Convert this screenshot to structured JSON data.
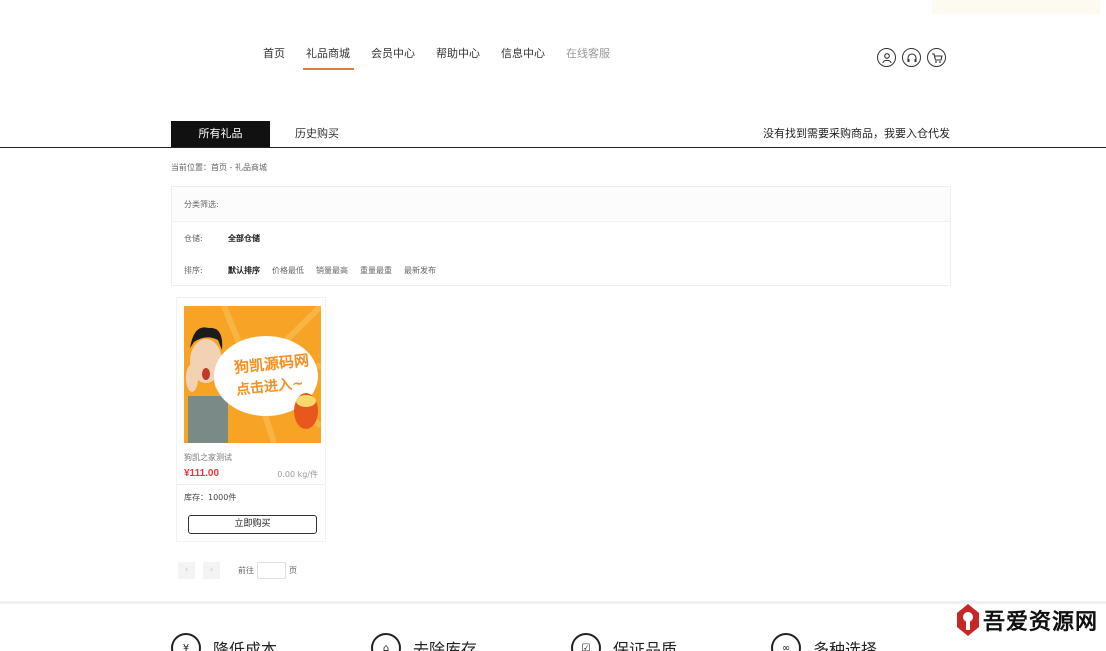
{
  "nav": {
    "items": [
      {
        "label": "首页",
        "state": "normal"
      },
      {
        "label": "礼品商城",
        "state": "active"
      },
      {
        "label": "会员中心",
        "state": "normal"
      },
      {
        "label": "帮助中心",
        "state": "normal"
      },
      {
        "label": "信息中心",
        "state": "normal"
      },
      {
        "label": "在线客服",
        "state": "muted"
      }
    ],
    "icons": [
      "user-icon",
      "headset-icon",
      "cart-icon"
    ]
  },
  "tabs": {
    "all_gifts": "所有礼品",
    "history": "历史购买",
    "right_link": "没有找到需要采购商品，我要入仓代发"
  },
  "breadcrumb": "当前位置：首页 - 礼品商城",
  "filters": {
    "category_label": "分类筛选:",
    "warehouse_label": "仓储:",
    "warehouse_selected": "全部仓储",
    "sort_label": "排序:",
    "sort_options": [
      "默认排序",
      "价格最低",
      "销量最高",
      "重量最重",
      "最新发布"
    ]
  },
  "product": {
    "image_text_line1": "狗凯源码网",
    "image_text_line2": "点击进入~",
    "name": "狗凯之家测试",
    "price": "¥111.00",
    "weight": "0.00 kg/件",
    "stock": "库存：1000件",
    "buy_label": "立即购买"
  },
  "pagination": {
    "prev": "‹",
    "next": "›",
    "goto_prefix": "前往",
    "goto_suffix": "页"
  },
  "features": [
    {
      "label": "降低成本",
      "icon": "coin-icon"
    },
    {
      "label": "去除库存",
      "icon": "home-icon"
    },
    {
      "label": "保证品质",
      "icon": "check-box-icon"
    },
    {
      "label": "多种选择",
      "icon": "options-icon"
    }
  ],
  "watermark": "吾爱资源网",
  "colors": {
    "accent": "#e07b39",
    "price": "#e4393c",
    "dark": "#111111",
    "image_bg": "#f7a325"
  }
}
